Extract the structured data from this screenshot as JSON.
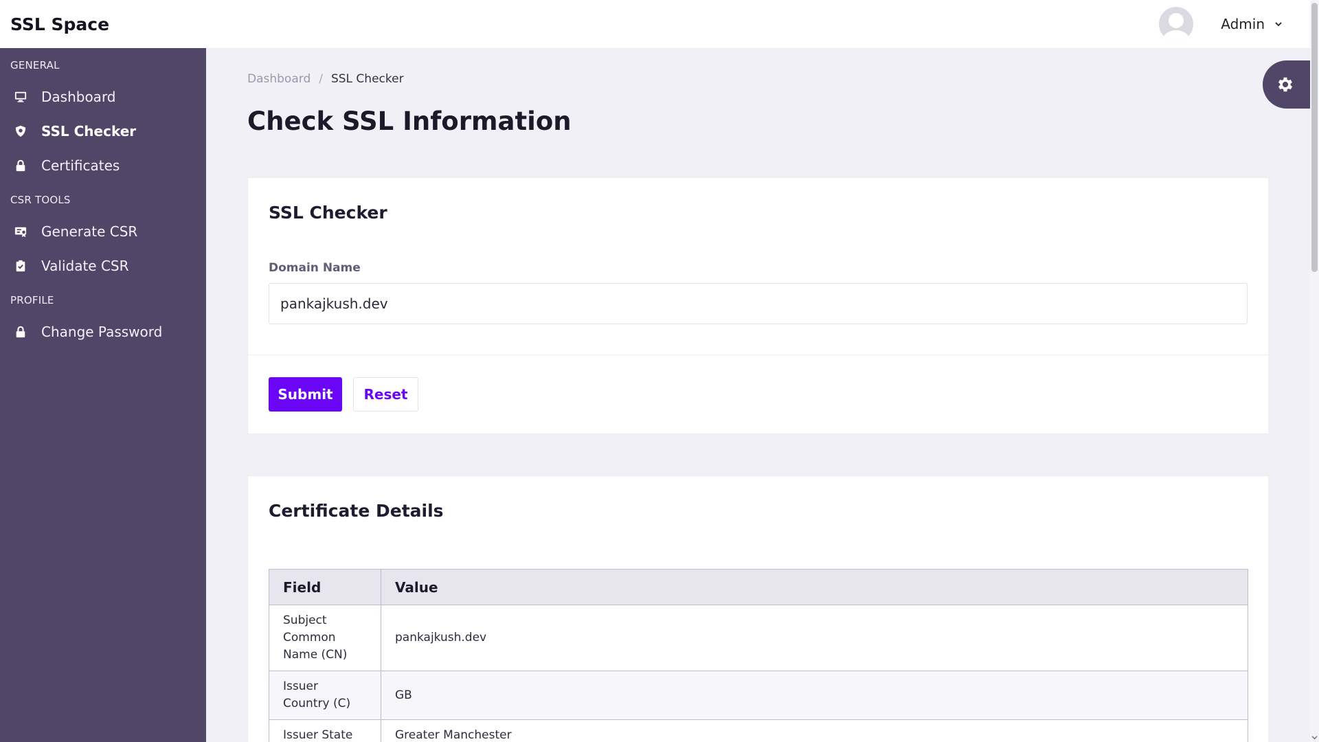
{
  "app": {
    "brand": "SSL Space"
  },
  "user": {
    "name": "Admin"
  },
  "sidebar": {
    "sections": [
      {
        "title": "GENERAL",
        "items": [
          {
            "label": "Dashboard",
            "icon": "monitor-icon"
          },
          {
            "label": "SSL Checker",
            "icon": "shield-icon",
            "active": true
          },
          {
            "label": "Certificates",
            "icon": "lock-icon"
          }
        ]
      },
      {
        "title": "CSR TOOLS",
        "items": [
          {
            "label": "Generate CSR",
            "icon": "certificate-icon"
          },
          {
            "label": "Validate CSR",
            "icon": "clipboard-check-icon"
          }
        ]
      },
      {
        "title": "PROFILE",
        "items": [
          {
            "label": "Change Password",
            "icon": "lock-icon"
          }
        ]
      }
    ]
  },
  "breadcrumb": {
    "root": "Dashboard",
    "separator": "/",
    "current": "SSL Checker"
  },
  "page": {
    "title": "Check SSL Information"
  },
  "checker_form": {
    "title": "SSL Checker",
    "domain_label": "Domain Name",
    "domain_value": "pankajkush.dev",
    "submit_label": "Submit",
    "reset_label": "Reset"
  },
  "certificate_details": {
    "title": "Certificate Details",
    "columns": [
      "Field",
      "Value"
    ],
    "rows": [
      {
        "field": "Subject Common Name (CN)",
        "value": "pankajkush.dev"
      },
      {
        "field": "Issuer Country (C)",
        "value": "GB"
      },
      {
        "field": "Issuer State",
        "value": "Greater Manchester"
      }
    ]
  },
  "colors": {
    "accent": "#6a06f5",
    "sidebar": "#514668"
  }
}
